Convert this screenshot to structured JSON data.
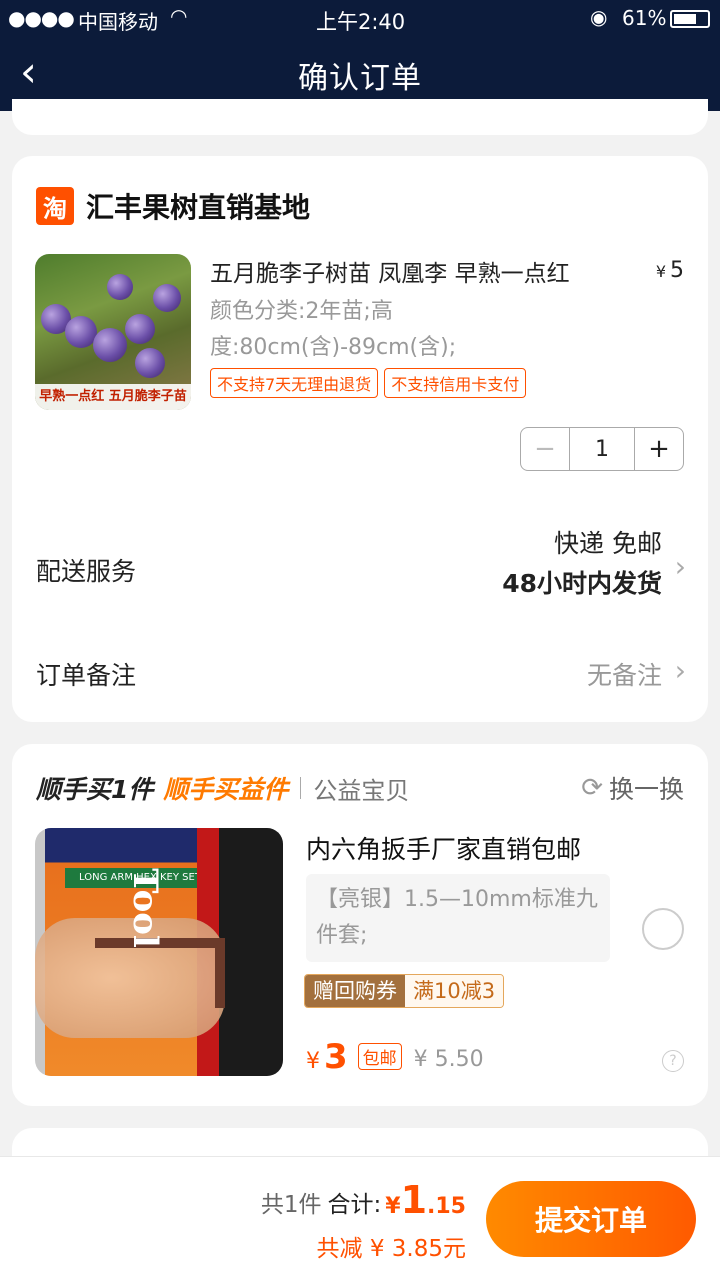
{
  "status_bar": {
    "carrier": "中国移动",
    "time": "上午2:40",
    "battery": "61%"
  },
  "nav": {
    "title": "确认订单"
  },
  "store": {
    "logo": "淘",
    "name": "汇丰果树直销基地",
    "product": {
      "title": "五月脆李子树苗 凤凰李 早熟一点红",
      "price_currency": "¥",
      "price": "5",
      "spec": "颜色分类:2年苗;高度:80cm(含)-89cm(含);",
      "image_caption": "早熟一点红  五月脆李子苗",
      "tags": [
        "不支持7天无理由退货",
        "不支持信用卡支付"
      ],
      "quantity": "1"
    },
    "delivery": {
      "label": "配送服务",
      "line1": "快递 免邮",
      "line2": "48小时内发货"
    },
    "remark": {
      "label": "订单备注",
      "value": "无备注"
    }
  },
  "buy_along": {
    "heading1": "顺手买1件",
    "heading2": "顺手买益件",
    "heading3": "公益宝贝",
    "swap_label": "换一换",
    "product": {
      "title": "内六角扳手厂家直销包邮",
      "spec": "【亮银】1.5—10mm标准九件套;",
      "coupon_left": "赠回购券",
      "coupon_right": "满10减3",
      "price_currency": "¥",
      "price": "3",
      "ship_tag": "包邮",
      "original_price": "¥ 5.50",
      "image_text": "Tool",
      "image_band": "LONG ARM HEX KEY SET"
    }
  },
  "footer": {
    "count": "共1件",
    "total_label": "合计:",
    "currency": "¥",
    "total_int": "1",
    "total_dec": ".15",
    "savings": "共减 ¥ 3.85元",
    "submit_label": "提交订单"
  },
  "colors": {
    "accent": "#ff5000",
    "nav_bg": "#0c1b3a"
  }
}
